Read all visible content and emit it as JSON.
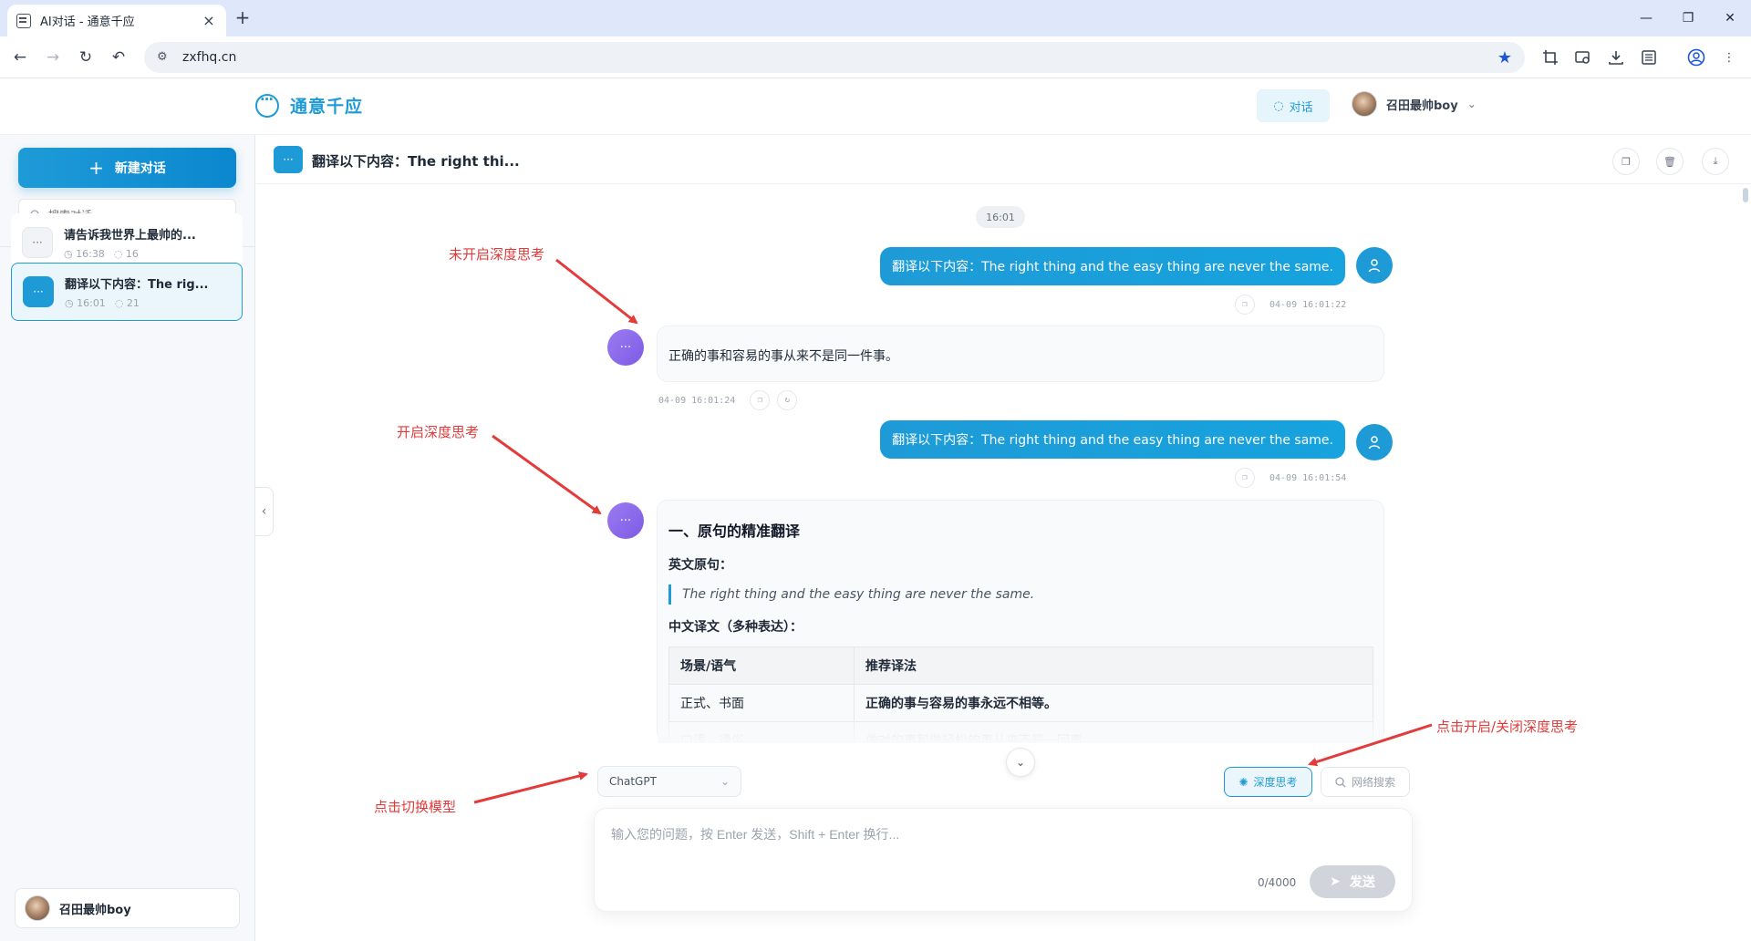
{
  "browser": {
    "tab_title": "AI对话 - 通意千应",
    "url": "zxfhq.cn"
  },
  "header": {
    "brand": "通意千应",
    "chat_button": "对话",
    "user_name": "召田最帅boy"
  },
  "sidebar": {
    "new_chat_label": "新建对话",
    "search_placeholder": "搜索对话...",
    "conversations": [
      {
        "title": "请告诉我世界上最帅的...",
        "time": "16:38",
        "count": "16",
        "active": false
      },
      {
        "title": "翻译以下内容：The rig...",
        "time": "16:01",
        "count": "21",
        "active": true
      }
    ],
    "user_name": "召田最帅boy"
  },
  "chat": {
    "title": "翻译以下内容：The right thi...",
    "time_divider": "16:01",
    "messages": [
      {
        "role": "user",
        "text": "翻译以下内容：The right thing and the easy thing are never the same.",
        "timestamp": "04-09 16:01:22"
      },
      {
        "role": "assistant",
        "text": "正确的事和容易的事从来不是同一件事。",
        "timestamp": "04-09 16:01:24"
      },
      {
        "role": "user",
        "text": "翻译以下内容：The right thing and the easy thing are never the same.",
        "timestamp": "04-09 16:01:54"
      }
    ],
    "deep_answer": {
      "heading": "一、原句的精准翻译",
      "source_label": "英文原句：",
      "source_quote": "The right thing and the easy thing are never the same.",
      "translation_label": "中文译文（多种表达）：",
      "table": {
        "headers": [
          "场景/语气",
          "推荐译法"
        ],
        "rows": [
          [
            "正式、书面",
            "正确的事与容易的事永远不相等。"
          ],
          [
            "口语、通俗",
            "做对的事和做轻松的事从来不是一回事。"
          ]
        ]
      }
    }
  },
  "composer": {
    "model": "ChatGPT",
    "deep_think_label": "深度思考",
    "web_search_label": "网络搜索",
    "placeholder": "输入您的问题，按 Enter 发送，Shift + Enter 换行...",
    "char_count": "0/4000",
    "send_label": "发送"
  },
  "annotations": {
    "no_deep_think": "未开启深度思考",
    "deep_think_on": "开启深度思考",
    "toggle_deep_think": "点击开启/关闭深度思考",
    "switch_model": "点击切换模型"
  },
  "colors": {
    "accent": "#1e9bd7",
    "bot_avatar": "#8b6cf0",
    "annotation": "#e33a3a"
  }
}
